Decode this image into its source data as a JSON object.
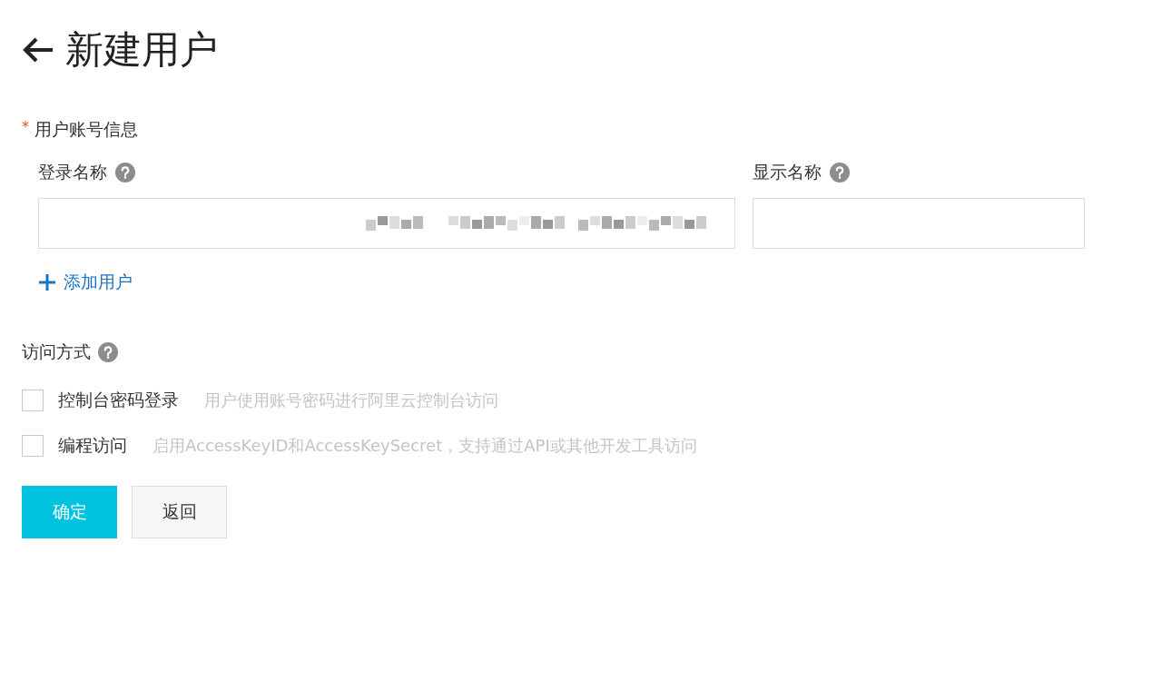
{
  "page": {
    "title": "新建用户"
  },
  "account_section": {
    "required_mark": "*",
    "label": "用户账号信息",
    "fields": [
      {
        "kind": "redacted",
        "label": "登录名称",
        "help": true
      },
      {
        "kind": "empty",
        "label": "显示名称",
        "help": true
      }
    ],
    "add_link": "添加用户"
  },
  "access_section": {
    "label": "访问方式",
    "help": true,
    "options": [
      {
        "label": "控制台密码登录",
        "description": "用户使用账号密码进行阿里云控制台访问",
        "checked": false
      },
      {
        "label": "编程访问",
        "description": "启用AccessKeyID和AccessKeySecret，支持通过API或其他开发工具访问",
        "checked": false
      }
    ]
  },
  "buttons": [
    {
      "label": "确定",
      "kind": "primary"
    },
    {
      "label": "返回",
      "kind": "secondary"
    }
  ]
}
